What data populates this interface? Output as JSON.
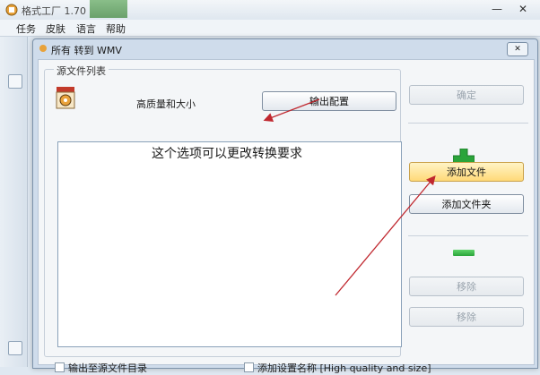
{
  "main_window": {
    "title": "格式工厂 1.70",
    "controls": {
      "minimize": "—",
      "close": "✕"
    }
  },
  "menu": [
    "任务",
    "皮肤",
    "语言",
    "帮助"
  ],
  "dialog": {
    "title": "所有 转到 WMV",
    "close": "✕",
    "group_label": "源文件列表",
    "quality": "高质量和大小",
    "output_config": "输出配置",
    "ok": "确定",
    "add_file": "添加文件",
    "add_folder": "添加文件夹",
    "remove": "移除",
    "clear": "移除",
    "annotation": "这个选项可以更改转换要求",
    "checkbox_output_to_source": "输出至源文件目录",
    "checkbox_add_setting_name": "添加设置名称 [High quality and size]"
  },
  "colors": {
    "annotation_arrow": "#c0282f",
    "add_icon": "#2aa43a",
    "hot_button": "#ffd978"
  },
  "icons": [
    "app-icon",
    "format-icon",
    "plus-icon",
    "minus-icon"
  ]
}
